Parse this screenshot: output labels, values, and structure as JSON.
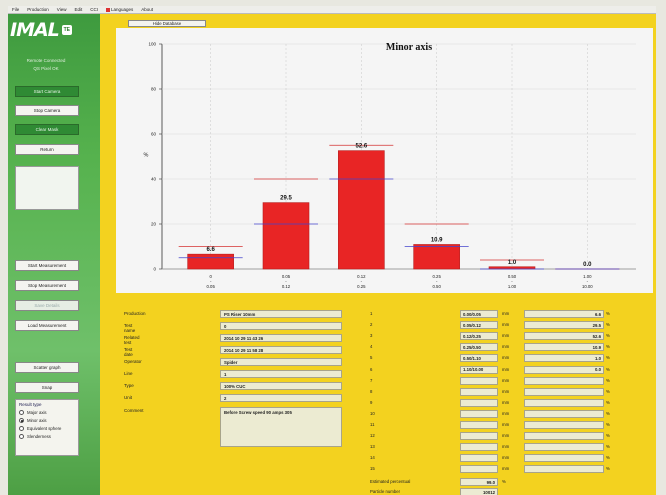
{
  "menu": [
    "File",
    "Production",
    "View",
    "Edit",
    "CCI",
    "Languages",
    "About"
  ],
  "brand": {
    "logo": "IMAL",
    "logo_mark": "TE",
    "sub1": "Remote Connected",
    "sub2": "QS Pixel OK"
  },
  "sidebar_buttons_top": [
    {
      "label": "Start Camera",
      "style": "green"
    },
    {
      "label": "Stop Camera",
      "style": "white"
    },
    {
      "label": "Clear Mask",
      "style": "green"
    },
    {
      "label": "Return",
      "style": "white"
    }
  ],
  "sidebar_buttons_bottom": [
    {
      "label": "Start Measurement",
      "style": "white"
    },
    {
      "label": "Stop Measurement",
      "style": "white"
    },
    {
      "label": "Save Details",
      "style": "disabled"
    },
    {
      "label": "Load Measurement",
      "style": "white"
    },
    {
      "label": "Scatter graph",
      "style": "white"
    },
    {
      "label": "Snap",
      "style": "white"
    }
  ],
  "particle_group": {
    "title": "Result type",
    "options": [
      {
        "label": "Major axis",
        "checked": false
      },
      {
        "label": "Minor axis",
        "checked": true
      },
      {
        "label": "Equivalent sphere",
        "checked": false
      },
      {
        "label": "Slenderness",
        "checked": false
      }
    ]
  },
  "hide_button": "Hide Database",
  "chart_data": {
    "type": "bar",
    "title": "Minor axis",
    "ylabel": "%",
    "ylim": [
      0,
      100
    ],
    "yticks": [
      0,
      20,
      40,
      60,
      80,
      100
    ],
    "categories": [
      "0\n-\n0.05",
      "0.05\n-\n0.12",
      "0.12\n-\n0.25",
      "0.25\n-\n0.50",
      "0.50\n-\n1.00",
      "1.00\n-\n10.00"
    ],
    "cat_top": [
      "0",
      "0.05",
      "0.12",
      "0.25",
      "0.50",
      "1.00"
    ],
    "cat_bottom": [
      "0.05",
      "0.12",
      "0.25",
      "0.50",
      "1.00",
      "10.00"
    ],
    "values": [
      6.6,
      29.5,
      52.6,
      10.9,
      1.0,
      0.0
    ],
    "labels": [
      "6.6",
      "29.5",
      "52.6",
      "10.9",
      "1.0",
      "0.0"
    ],
    "upper_ref": [
      10,
      40,
      55,
      20,
      4,
      0
    ],
    "lower_ref": [
      5,
      20,
      40,
      10,
      0,
      0
    ],
    "colors": {
      "bar": "#e82525",
      "upper": "#d43030",
      "lower": "#4444cc"
    }
  },
  "details": [
    {
      "label": "Production",
      "value": "PS Riser 10mm"
    },
    {
      "label": "Test name",
      "value": "0"
    },
    {
      "label": "Related test",
      "value": "2014 10 29 11 43 26"
    },
    {
      "label": "Test date",
      "value": "2014 10 29 11 58 28"
    },
    {
      "label": "Operator",
      "value": "Spider"
    },
    {
      "label": "Line",
      "value": "1"
    },
    {
      "label": "Type",
      "value": "100% CUC"
    },
    {
      "label": "Unit",
      "value": "2"
    },
    {
      "label": "Comment",
      "value": "Before Screw speed 90 amps 305"
    }
  ],
  "ranges": [
    {
      "n": "1",
      "size": "0.00/0.05",
      "unit": "mm",
      "pct": "6.6"
    },
    {
      "n": "2",
      "size": "0.05/0.12",
      "unit": "mm",
      "pct": "29.5"
    },
    {
      "n": "3",
      "size": "0.12/0.25",
      "unit": "mm",
      "pct": "52.6"
    },
    {
      "n": "4",
      "size": "0.25/0.50",
      "unit": "mm",
      "pct": "10.9"
    },
    {
      "n": "5",
      "size": "0.50/1.10",
      "unit": "mm",
      "pct": "1.0"
    },
    {
      "n": "6",
      "size": "1.10/10.00",
      "unit": "mm",
      "pct": "0.0"
    },
    {
      "n": "7",
      "size": "",
      "unit": "mm",
      "pct": ""
    },
    {
      "n": "8",
      "size": "",
      "unit": "mm",
      "pct": ""
    },
    {
      "n": "9",
      "size": "",
      "unit": "mm",
      "pct": ""
    },
    {
      "n": "10",
      "size": "",
      "unit": "mm",
      "pct": ""
    },
    {
      "n": "11",
      "size": "",
      "unit": "mm",
      "pct": ""
    },
    {
      "n": "12",
      "size": "",
      "unit": "mm",
      "pct": ""
    },
    {
      "n": "13",
      "size": "",
      "unit": "mm",
      "pct": ""
    },
    {
      "n": "14",
      "size": "",
      "unit": "mm",
      "pct": ""
    },
    {
      "n": "15",
      "size": "",
      "unit": "mm",
      "pct": ""
    }
  ],
  "footer": [
    {
      "label": "Estimated percentual",
      "value": "99.0",
      "unit": "%"
    },
    {
      "label": "Particle number",
      "value": "10012"
    }
  ]
}
